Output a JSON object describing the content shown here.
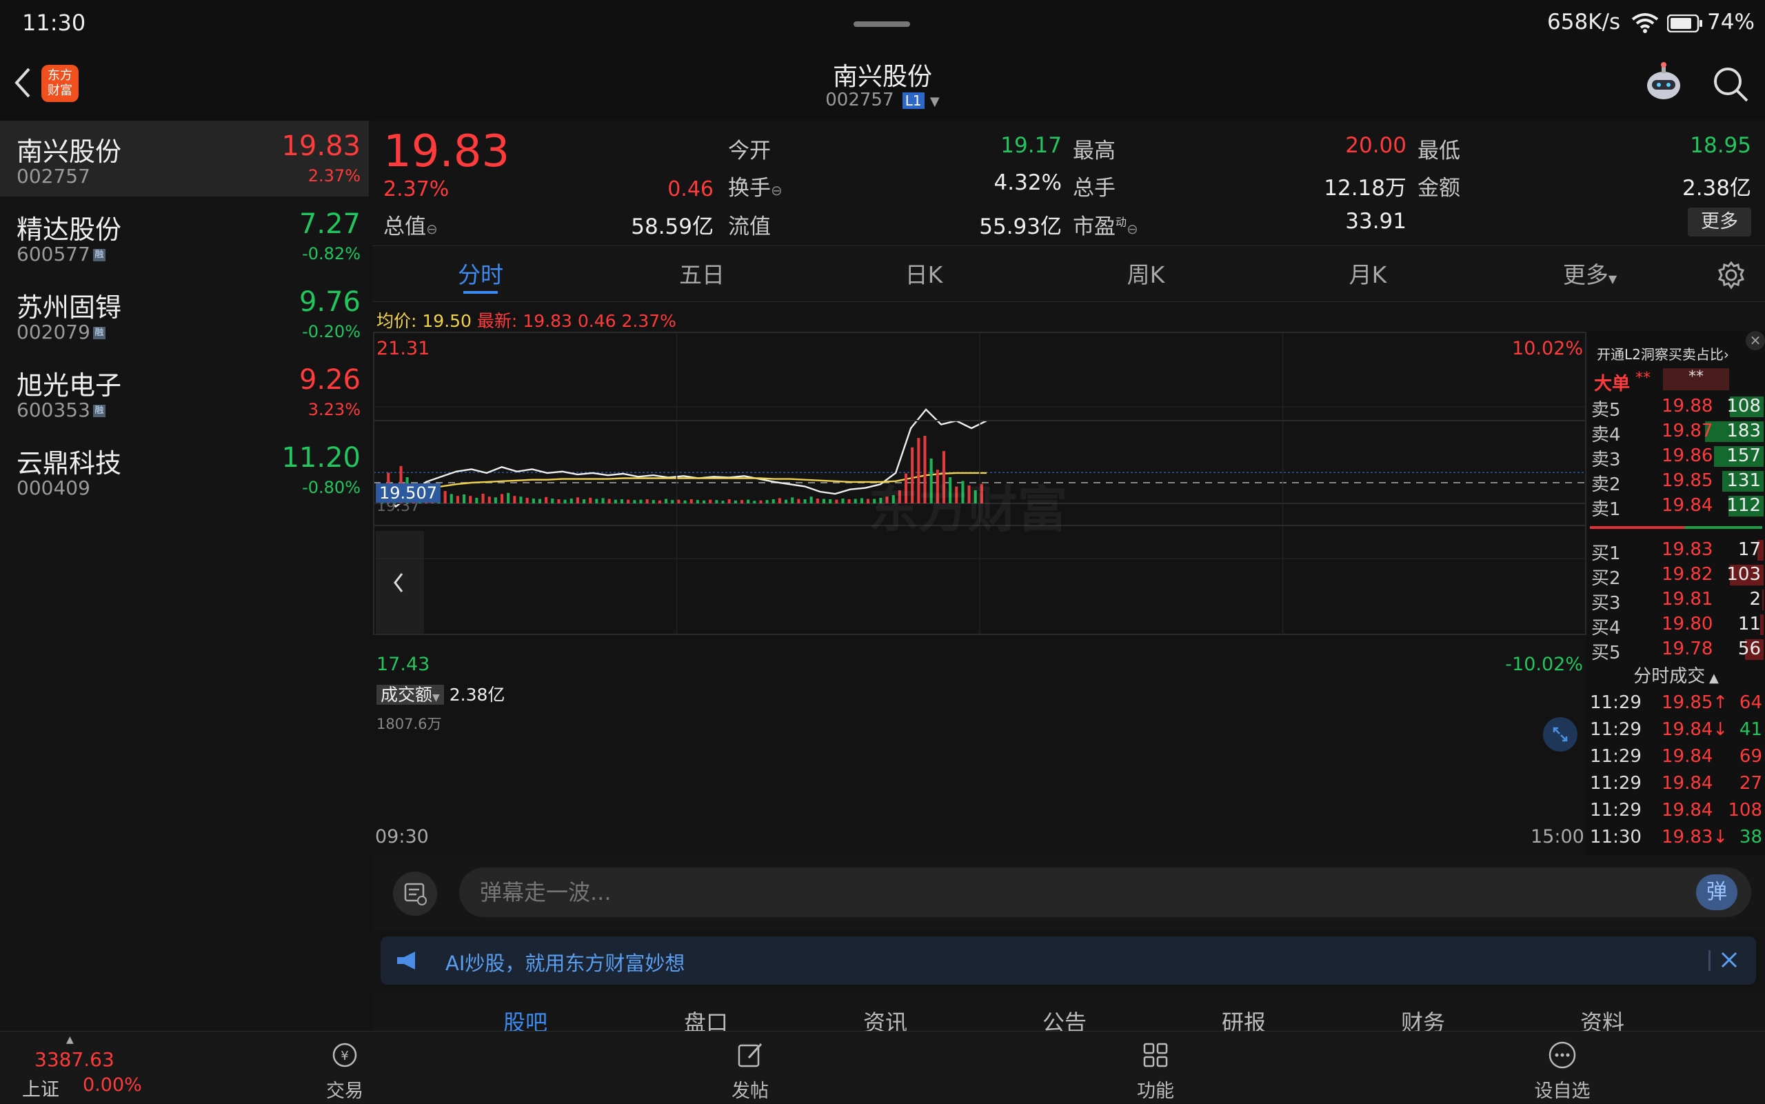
{
  "status": {
    "time": "11:30",
    "speed": "658K/s",
    "battery": "74%"
  },
  "header": {
    "title": "南兴股份",
    "code": "002757",
    "level_badge": "L1",
    "logo_text": "东方财富"
  },
  "sidebar": [
    {
      "name": "南兴股份",
      "code": "002757",
      "price": "19.83",
      "pct": "2.37%",
      "dir": "up",
      "tag": ""
    },
    {
      "name": "精达股份",
      "code": "600577",
      "price": "7.27",
      "pct": "-0.82%",
      "dir": "down",
      "tag": "融"
    },
    {
      "name": "苏州固锝",
      "code": "002079",
      "price": "9.76",
      "pct": "-0.20%",
      "dir": "down",
      "tag": "融"
    },
    {
      "name": "旭光电子",
      "code": "600353",
      "price": "9.26",
      "pct": "3.23%",
      "dir": "up",
      "tag": "融"
    },
    {
      "name": "云鼎科技",
      "code": "000409",
      "price": "11.20",
      "pct": "-0.80%",
      "dir": "down",
      "tag": ""
    }
  ],
  "quote": {
    "price": "19.83",
    "pct": "2.37%",
    "change": "0.46",
    "total_value_label": "总值",
    "total_value": "58.59亿",
    "open_label": "今开",
    "open": "19.17",
    "turnover_label": "换手",
    "turnover": "4.32%",
    "float_label": "流值",
    "float_value": "55.93亿",
    "high_label": "最高",
    "high": "20.00",
    "volume_label": "总手",
    "volume": "12.18万",
    "pe_label": "市盈",
    "pe_sup": "动",
    "pe": "33.91",
    "low_label": "最低",
    "low": "18.95",
    "amount_label": "金额",
    "amount": "2.38亿",
    "more": "更多"
  },
  "tabs": [
    "分时",
    "五日",
    "日K",
    "周K",
    "月K",
    "更多"
  ],
  "chart_info": {
    "avg_label": "均价:",
    "avg": "19.50",
    "latest_label": "最新:",
    "latest": "19.83",
    "chg": "0.46",
    "pct": "2.37%"
  },
  "chart_data": {
    "type": "line",
    "y_max_label": "21.31",
    "y_min_label": "17.43",
    "pct_max_label": "10.02%",
    "pct_min_label": "-10.02%",
    "crosshair_value": "19.507",
    "prev_close_label": "19.37",
    "ylim": [
      17.43,
      21.31
    ],
    "prev_close": 19.37,
    "x_start": "09:30",
    "x_end": "15:00",
    "watermark": "东方财富",
    "series": [
      {
        "name": "最新",
        "color": "#f0f0f0",
        "values": [
          19.3,
          19.05,
          19.2,
          19.38,
          19.45,
          19.52,
          19.55,
          19.5,
          19.58,
          19.52,
          19.55,
          19.5,
          19.52,
          19.48,
          19.5,
          19.47,
          19.49,
          19.45,
          19.47,
          19.44,
          19.46,
          19.43,
          19.45,
          19.44,
          19.46,
          19.42,
          19.38,
          19.35,
          19.32,
          19.25,
          19.22,
          19.28,
          19.3,
          19.35,
          19.5,
          20.1,
          20.35,
          20.15,
          20.2,
          20.1,
          20.2
        ]
      },
      {
        "name": "均价",
        "color": "#f2d24b",
        "values": [
          19.2,
          19.15,
          19.22,
          19.28,
          19.32,
          19.35,
          19.37,
          19.38,
          19.39,
          19.4,
          19.41,
          19.41,
          19.42,
          19.42,
          19.42,
          19.42,
          19.43,
          19.43,
          19.43,
          19.43,
          19.43,
          19.43,
          19.43,
          19.43,
          19.43,
          19.43,
          19.42,
          19.42,
          19.41,
          19.4,
          19.39,
          19.38,
          19.38,
          19.38,
          19.39,
          19.43,
          19.47,
          19.49,
          19.5,
          19.5,
          19.5
        ]
      }
    ],
    "volume": {
      "label": "成交额",
      "total": "2.38亿",
      "max_label": "1807.6万",
      "max": 1807.6,
      "bars": [
        450,
        820,
        380,
        1000,
        700,
        450,
        280,
        350,
        450,
        230,
        330,
        250,
        200,
        240,
        200,
        150,
        260,
        180,
        160,
        250,
        280,
        200,
        180,
        150,
        130,
        120,
        170,
        130,
        110,
        100,
        130,
        160,
        110,
        150,
        120,
        140,
        120,
        100,
        110,
        100,
        90,
        100,
        110,
        90,
        80,
        120,
        90,
        100,
        80,
        110,
        90,
        80,
        100,
        90,
        70,
        110,
        80,
        90,
        100,
        70,
        80,
        90,
        110,
        140,
        100,
        160,
        120,
        110,
        180,
        130,
        120,
        110,
        100,
        130,
        110,
        120,
        140,
        120,
        120,
        150,
        180,
        220,
        350,
        800,
        1500,
        1750,
        1807,
        1200,
        900,
        1400,
        700,
        450,
        600,
        480,
        350,
        520
      ],
      "up": [
        0,
        1,
        0,
        1,
        0,
        1,
        0,
        1,
        1,
        0,
        1,
        0,
        1,
        0,
        1,
        0,
        1,
        1,
        0,
        1,
        0,
        1,
        0,
        1,
        0,
        0,
        1,
        0,
        1,
        0,
        0,
        1,
        0,
        1,
        0,
        0,
        1,
        0,
        0,
        1,
        0,
        0,
        1,
        0,
        1,
        0,
        0,
        1,
        0,
        1,
        0,
        0,
        1,
        0,
        0,
        1,
        0,
        1,
        0,
        0,
        1,
        0,
        0,
        1,
        0,
        0,
        1,
        0,
        0,
        1,
        0,
        0,
        1,
        0,
        1,
        0,
        0,
        1,
        0,
        0,
        1,
        0,
        1,
        1,
        1,
        1,
        1,
        0,
        1,
        1,
        0,
        1,
        0,
        1,
        0,
        1
      ]
    }
  },
  "orderbook": {
    "header": "开通L2洞察买卖占比",
    "big_label": "大单",
    "big_mask1": "**",
    "big_mask2": "**",
    "asks": [
      {
        "label": "卖5",
        "price": "19.88",
        "vol": "108"
      },
      {
        "label": "卖4",
        "price": "19.87",
        "vol": "183"
      },
      {
        "label": "卖3",
        "price": "19.86",
        "vol": "157"
      },
      {
        "label": "卖2",
        "price": "19.85",
        "vol": "131"
      },
      {
        "label": "卖1",
        "price": "19.84",
        "vol": "112"
      }
    ],
    "bids": [
      {
        "label": "买1",
        "price": "19.83",
        "vol": "17"
      },
      {
        "label": "买2",
        "price": "19.82",
        "vol": "103"
      },
      {
        "label": "买3",
        "price": "19.81",
        "vol": "2"
      },
      {
        "label": "买4",
        "price": "19.80",
        "vol": "11"
      },
      {
        "label": "买5",
        "price": "19.78",
        "vol": "56"
      }
    ],
    "ask_vol_fraction": [
      0.55,
      0.95,
      0.8,
      0.67,
      0.57
    ],
    "bid_vol_fraction": [
      0.1,
      0.55,
      0.02,
      0.06,
      0.3
    ],
    "ticks_title": "分时成交",
    "ticks": [
      {
        "time": "11:29",
        "price": "19.85↑",
        "vol": "64",
        "dir": "up"
      },
      {
        "time": "11:29",
        "price": "19.84↓",
        "vol": "41",
        "dir": "down"
      },
      {
        "time": "11:29",
        "price": "19.84",
        "vol": "69",
        "dir": "up"
      },
      {
        "time": "11:29",
        "price": "19.84",
        "vol": "27",
        "dir": "up"
      },
      {
        "time": "11:29",
        "price": "19.84",
        "vol": "108",
        "dir": "up"
      },
      {
        "time": "11:30",
        "price": "19.83↓",
        "vol": "38",
        "dir": "down"
      }
    ]
  },
  "input": {
    "placeholder": "弹幕走一波...",
    "danmu_btn": "弹"
  },
  "notice": {
    "text": "AI炒股，就用东方财富妙想"
  },
  "bottom_tabs": [
    "股吧",
    "盘口",
    "资讯",
    "公告",
    "研报",
    "财务",
    "资料"
  ],
  "bottom_nav": {
    "index_value": "3387.63",
    "index_name": "上证",
    "index_pct": "0.00%",
    "items": [
      "交易",
      "发帖",
      "功能",
      "设自选"
    ]
  },
  "colors": {
    "up": "#ff3b3b",
    "down": "#22c55e",
    "accent": "#3b8bf0",
    "avg_line": "#f2d24b"
  }
}
